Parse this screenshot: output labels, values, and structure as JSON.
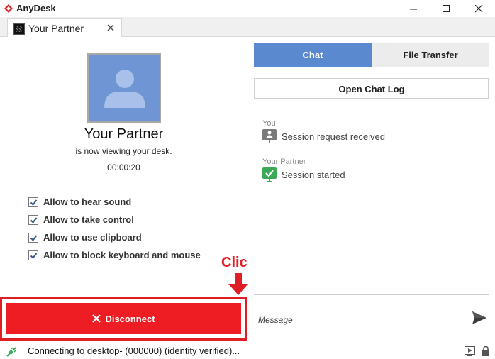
{
  "app": {
    "title": "AnyDesk",
    "accent_color": "#e01e26"
  },
  "tab": {
    "label": "Your Partner",
    "icon": "remote-desktop-icon"
  },
  "partner": {
    "name": "Your Partner",
    "status": "is now viewing your desk.",
    "session_time": "00:00:20",
    "avatar_icon": "user-avatar-icon",
    "avatar_color": "#7095d4"
  },
  "permissions": [
    {
      "label": "Allow to hear sound",
      "checked": true
    },
    {
      "label": "Allow to take control",
      "checked": true
    },
    {
      "label": "Allow to use clipboard",
      "checked": true
    },
    {
      "label": "Allow to block keyboard and mouse",
      "checked": true
    }
  ],
  "annotation": {
    "click_label": "Click"
  },
  "disconnect": {
    "label": "Disconnect",
    "color": "#ee1d24"
  },
  "side_tabs": {
    "chat": "Chat",
    "file_transfer": "File Transfer",
    "active_color": "#5a89cf"
  },
  "chat": {
    "open_log_label": "Open Chat Log",
    "entries": [
      {
        "sender": "You",
        "text": "Session request received",
        "icon": "desk-request-icon"
      },
      {
        "sender": "Your Partner",
        "text": "Session started",
        "icon": "session-started-check-icon"
      }
    ],
    "message_placeholder": "Message"
  },
  "statusbar": {
    "text": "Connecting to desktop- (000000) (identity verified)...",
    "connection_icon": "connection-plug-icon",
    "play_icon": "play-icon",
    "lock_icon": "lock-icon"
  }
}
